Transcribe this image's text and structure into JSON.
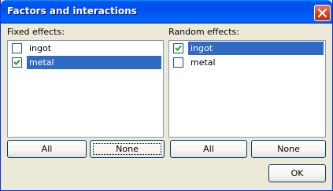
{
  "dialog": {
    "title": "Factors and interactions",
    "ok_label": "OK"
  },
  "fixed": {
    "label": "Fixed effects:",
    "items": [
      {
        "label": "ingot",
        "checked": false,
        "selected": false
      },
      {
        "label": "metal",
        "checked": true,
        "selected": true
      }
    ],
    "all_label": "All",
    "none_label": "None"
  },
  "random": {
    "label": "Random effects:",
    "items": [
      {
        "label": "ingot",
        "checked": true,
        "selected": true
      },
      {
        "label": "metal",
        "checked": false,
        "selected": false
      }
    ],
    "all_label": "All",
    "none_label": "None"
  },
  "colors": {
    "titlebar": "#0054e3",
    "selection": "#316ac5",
    "dialog_bg": "#ece9d8",
    "close_button": "#d5401d"
  }
}
